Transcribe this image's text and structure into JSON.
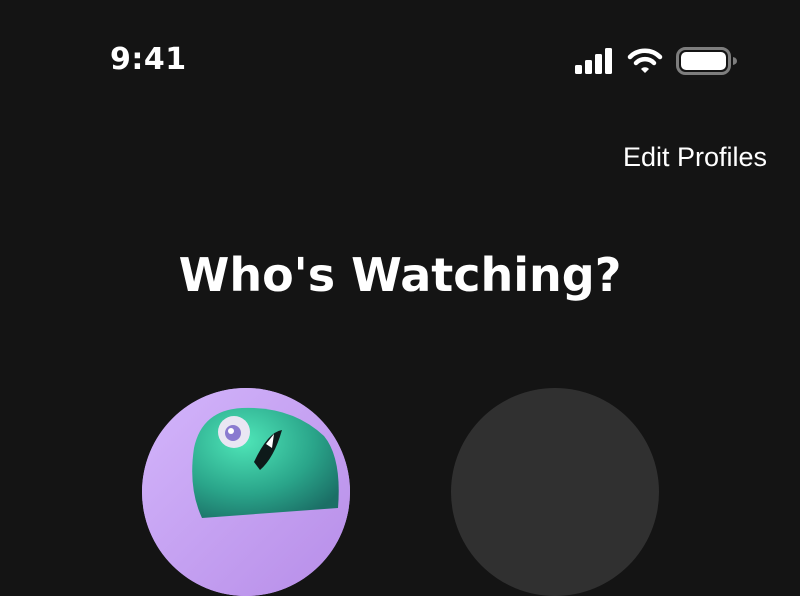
{
  "status_bar": {
    "time": "9:41",
    "icons": [
      "signal-icon",
      "wifi-icon",
      "battery-icon"
    ]
  },
  "header": {
    "edit_profiles_label": "Edit Profiles"
  },
  "main": {
    "title": "Who's Watching?",
    "profiles": [
      {
        "avatar": "green-monster-avatar",
        "color": "#c8a5f5"
      },
      {
        "avatar": "blank-avatar",
        "color": "#303030"
      }
    ]
  },
  "colors": {
    "background": "#141414",
    "text": "#ffffff",
    "accent_purple": "#c8a5f5",
    "accent_green": "#2fc7a0"
  }
}
